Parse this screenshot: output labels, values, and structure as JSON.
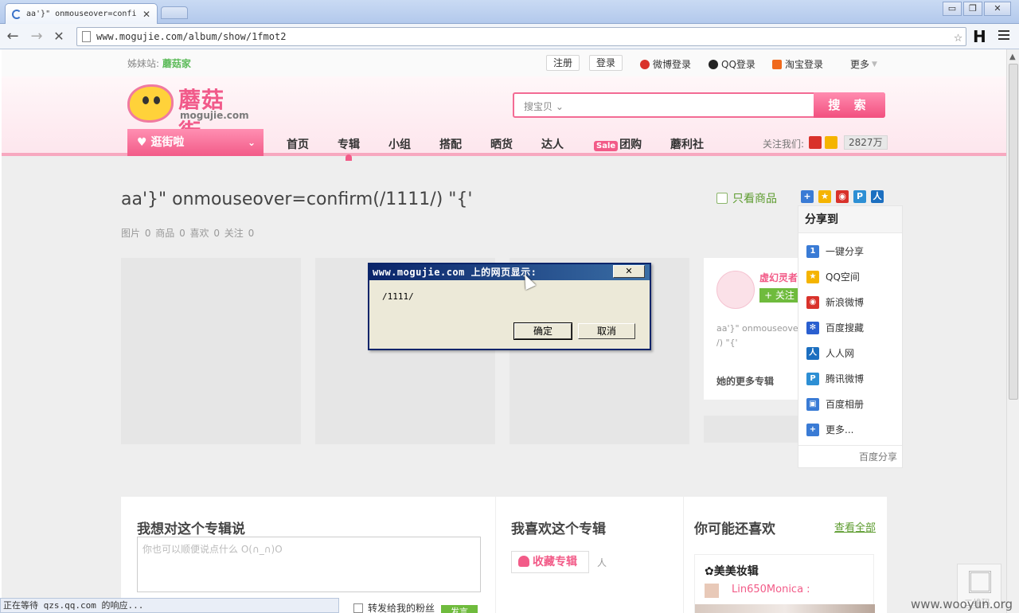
{
  "browser": {
    "tab_title": "aa'}\" onmouseover=confi",
    "tab_close": "✕",
    "url": "www.mogujie.com/album/show/1fmot2",
    "back": "←",
    "forward": "→",
    "stop": "✕",
    "star": "☆",
    "ext_label": "H",
    "window_controls": [
      "▭",
      "❐",
      "✕"
    ],
    "status_text": "正在等待 qzs.qq.com 的响应..."
  },
  "topbar": {
    "sister_label": "姊妹站:",
    "sister_site": "蘑菇家",
    "register": "注册",
    "login": "登录",
    "weibo_login": "微博登录",
    "qq_login": "QQ登录",
    "taobao_login": "淘宝登录",
    "more": "更多"
  },
  "header": {
    "logo_cn": "蘑菇街",
    "logo_en": "mogujie.com",
    "search_scope": "搜宝贝",
    "search_button": "搜 索",
    "guang": "逛街啦",
    "nav": [
      "首页",
      "专辑",
      "小组",
      "搭配",
      "晒货",
      "达人",
      "团购",
      "蘑利社"
    ],
    "sale_badge": "Sale",
    "follow_label": "关注我们:",
    "follow_count": "2827万"
  },
  "album": {
    "title": "aa'}\" onmouseover=confirm(/1111/) \"{'",
    "stats": "图片 0    商品 0    喜欢 0    关注 0",
    "only_goods": "只看商品"
  },
  "profile": {
    "name": "虚幻灵者",
    "follow_btn": "+ 关注",
    "desc_line1": "aa'}\" onmouseover",
    "desc_line2": "/) \"{'",
    "more_albums": "她的更多专辑"
  },
  "share": {
    "heading": "分享到",
    "items": [
      {
        "label": "一键分享",
        "icon": "one-click-share-icon",
        "color": "#3a7bd5"
      },
      {
        "label": "QQ空间",
        "icon": "qzone-icon",
        "color": "#f5b400"
      },
      {
        "label": "新浪微博",
        "icon": "sina-weibo-icon",
        "color": "#d9322b"
      },
      {
        "label": "百度搜藏",
        "icon": "baidu-icon",
        "color": "#2a5fd0"
      },
      {
        "label": "人人网",
        "icon": "renren-icon",
        "color": "#1c6fc0"
      },
      {
        "label": "腾讯微博",
        "icon": "tencent-weibo-icon",
        "color": "#2d8fd4"
      },
      {
        "label": "百度相册",
        "icon": "baidu-album-icon",
        "color": "#3a7bd5"
      },
      {
        "label": "更多...",
        "icon": "more-plus-icon",
        "color": "#3a7bd5"
      }
    ],
    "footer": "百度分享"
  },
  "lower": {
    "comment_heading": "我想对这个专辑说",
    "comment_placeholder": "你也可以顺便说点什么 O(∩_∩)O",
    "like_heading": "我喜欢这个专辑",
    "collect_btn": "收藏专辑",
    "people_suffix": "人",
    "rec_heading": "你可能还喜欢",
    "see_all": "查看全部",
    "rec_title": "✿美美妆辑",
    "rec_user": "Lin650Monica :",
    "share_to_fans": "转发给我的粉丝",
    "submit_btn": "发言",
    "qrcode_label": "二维码"
  },
  "dialog": {
    "title": "www.mogujie.com 上的网页显示:",
    "message": "/1111/",
    "ok": "确定",
    "cancel": "取消",
    "close": "✕"
  },
  "watermark": "www.wooyun.org"
}
